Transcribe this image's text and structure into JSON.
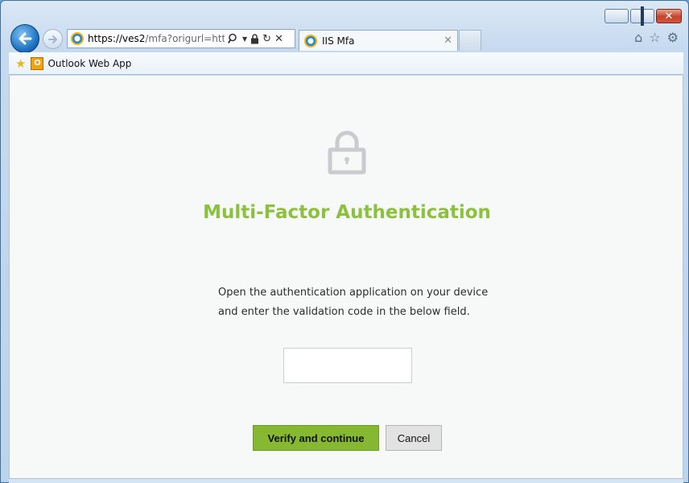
{
  "browser": {
    "address": {
      "host": "https://ves2",
      "rest": "/mfa?origurl=https%"
    },
    "tab": {
      "label": "IIS Mfa"
    },
    "favorites": [
      {
        "label": "Outlook Web App",
        "icon": "outlook-icon"
      }
    ],
    "icons": {
      "back": "back-arrow-icon",
      "forward": "forward-arrow-icon",
      "home": "home-icon",
      "favorites": "star-icon",
      "settings": "gear-icon"
    }
  },
  "page": {
    "title": "Multi-Factor Authentication",
    "instructions_line1": "Open the authentication application on your device",
    "instructions_line2": "and enter the validation code in the below field.",
    "code_value": "",
    "verify_label": "Verify and continue",
    "cancel_label": "Cancel",
    "colors": {
      "accent": "#8cc13f",
      "button": "#86b832"
    }
  }
}
